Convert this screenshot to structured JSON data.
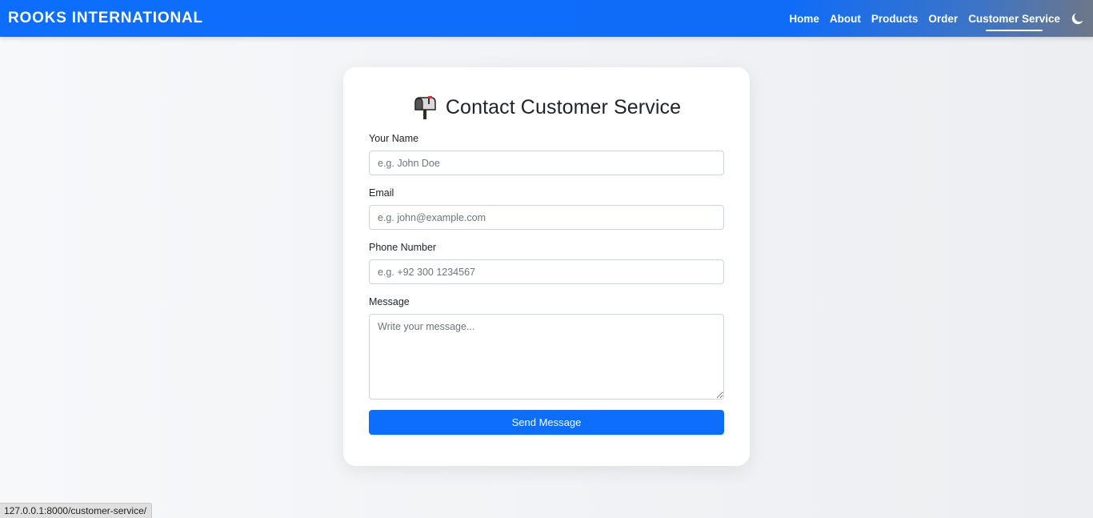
{
  "navbar": {
    "brand": "ROOKS INTERNATIONAL",
    "links": [
      {
        "label": "Home"
      },
      {
        "label": "About"
      },
      {
        "label": "Products"
      },
      {
        "label": "Order"
      },
      {
        "label": "Customer Service",
        "active": true
      }
    ],
    "theme_toggle_icon": "moon-icon"
  },
  "form": {
    "title_icon": "mailbox-icon",
    "title": "Contact Customer Service",
    "name": {
      "label": "Your Name",
      "placeholder": "e.g. John Doe",
      "value": ""
    },
    "email": {
      "label": "Email",
      "placeholder": "e.g. john@example.com",
      "value": ""
    },
    "phone": {
      "label": "Phone Number",
      "placeholder": "e.g. +92 300 1234567",
      "value": ""
    },
    "message": {
      "label": "Message",
      "placeholder": "Write your message...",
      "value": ""
    },
    "submit_label": "Send Message"
  },
  "status_bar": {
    "url": "127.0.0.1:8000/customer-service/"
  },
  "colors": {
    "primary": "#0d6efd",
    "card_bg": "#ffffff",
    "page_bg": "#f2f3f5"
  }
}
